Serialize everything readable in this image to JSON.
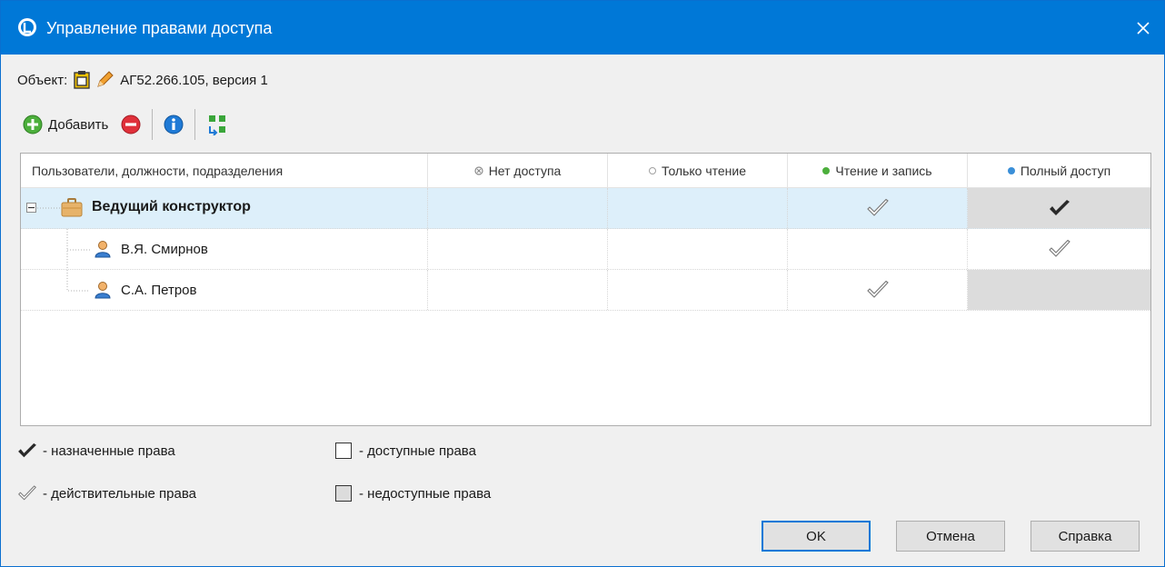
{
  "window": {
    "title": "Управление правами доступа",
    "close_label": "×"
  },
  "object": {
    "label": "Объект:",
    "value": "АГ52.266.105, версия 1"
  },
  "toolbar": {
    "add_label": "Добавить"
  },
  "grid": {
    "columns": [
      "Пользователи, должности, подразделения",
      "Нет доступа",
      "Только чтение",
      "Чтение и запись",
      "Полный доступ"
    ],
    "column_dot_colors": [
      "#8c8c8c",
      "#a0a0a0",
      "#4caf3c",
      "#3a8fd8"
    ],
    "rows": [
      {
        "name": "Ведущий конструктор",
        "kind": "group"
      },
      {
        "name": "В.Я. Смирнов",
        "kind": "user"
      },
      {
        "name": "С.А. Петров",
        "kind": "user"
      }
    ]
  },
  "legend": {
    "assigned": "- назначенные права",
    "effective": "- действительные права",
    "available": "- доступные права",
    "unavailable": "- недоступные права"
  },
  "buttons": {
    "ok": "OK",
    "cancel": "Отмена",
    "help": "Справка"
  },
  "colors": {
    "titlebar": "#0078d7",
    "selected_row": "#ddeffa",
    "unavailable_cell": "#dcdcdc"
  }
}
